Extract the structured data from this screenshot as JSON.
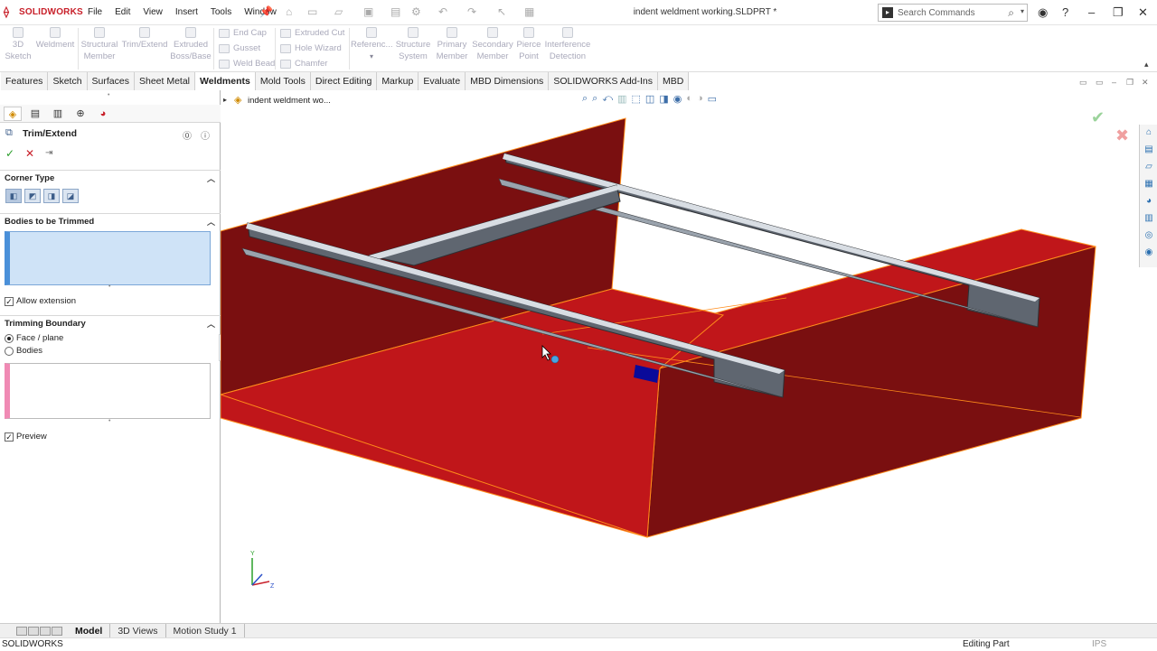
{
  "app": {
    "logo": "SOLIDWORKS",
    "doc_title": "indent weldment working.SLDPRT *",
    "search_placeholder": "Search Commands"
  },
  "menu": [
    "File",
    "Edit",
    "View",
    "Insert",
    "Tools",
    "Window"
  ],
  "commands": {
    "sketch3d": "3D Sketch",
    "weldment": "Weldment",
    "structural": "Structural Member",
    "trim": "Trim/Extend",
    "extruded_boss": "Extruded Boss/Base",
    "end_cap": "End Cap",
    "gusset": "Gusset",
    "weld_bead": "Weld Bead",
    "extruded_cut": "Extruded Cut",
    "hole_wizard": "Hole Wizard",
    "chamfer": "Chamfer",
    "reference": "Referenc...",
    "structure_system": "Structure System",
    "primary_member": "Primary Member",
    "secondary_member": "Secondary Member",
    "pierce_point": "Pierce Point",
    "interference": "Interference Detection"
  },
  "tabs": [
    "Features",
    "Sketch",
    "Surfaces",
    "Sheet Metal",
    "Weldments",
    "Mold Tools",
    "Direct Editing",
    "Markup",
    "Evaluate",
    "MBD Dimensions",
    "SOLIDWORKS Add-Ins",
    "MBD"
  ],
  "active_tab": "Weldments",
  "panel": {
    "title": "Trim/Extend",
    "corner_type": "Corner Type",
    "bodies_trimmed": "Bodies to be Trimmed",
    "allow_extension": "Allow extension",
    "trimming_boundary": "Trimming Boundary",
    "face_plane": "Face / plane",
    "bodies": "Bodies",
    "preview": "Preview"
  },
  "viewport": {
    "tree_label": "indent weldment wo..."
  },
  "bottom_tabs": [
    "Model",
    "3D Views",
    "Motion Study 1"
  ],
  "status": {
    "left": "SOLIDWORKS",
    "mode": "Editing Part",
    "units": "IPS"
  },
  "colors": {
    "body_red": "#c0161a",
    "body_dark": "#7a0f10",
    "edge_orange": "#ff8c1a",
    "beam_grey": "#6b7280"
  }
}
